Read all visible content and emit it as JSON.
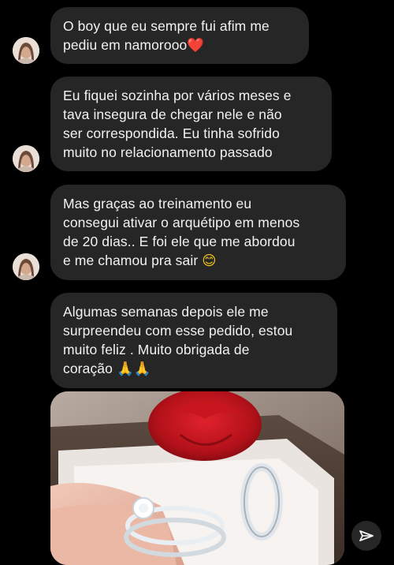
{
  "messages": [
    {
      "text": "O boy que eu sempre fui afim me\npediu em namorooo",
      "emoji": "❤️"
    },
    {
      "text": "Eu fiquei sozinha por vários meses e\ntava insegura de chegar nele e não\nser correspondida. Eu tinha sofrido\nmuito no relacionamento passado",
      "emoji": ""
    },
    {
      "text": "Mas graças ao treinamento eu\nconsegui ativar o arquétipo em menos\nde 20 dias.. E foi ele que me abordou\ne me chamou pra sair",
      "emoji": "😊"
    },
    {
      "text": "Algumas semanas depois ele me\nsurpreendeu com esse pedido, estou\nmuito feliz . Muito obrigada de\ncoração",
      "emoji": "🙏🙏"
    }
  ],
  "icons": {
    "avatar": "user-avatar-icon",
    "send": "send-paper-plane-icon"
  },
  "colors": {
    "background": "#000000",
    "bubble": "#262626",
    "text": "#f2f2f2"
  }
}
